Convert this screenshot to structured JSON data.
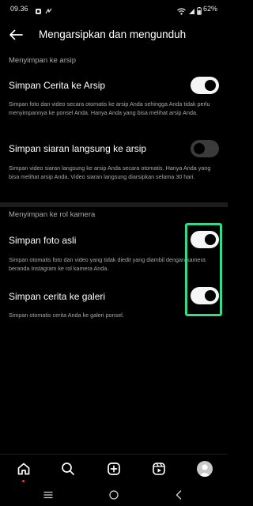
{
  "status_bar": {
    "time": "09.36",
    "battery": "62%",
    "icons": [
      "notification-icon",
      "app-icon",
      "wifi-icon",
      "signal-icon",
      "battery-icon"
    ]
  },
  "header": {
    "title": "Mengarsipkan dan mengunduh",
    "back_icon": "arrow-left-icon"
  },
  "sections": {
    "archive": {
      "title": "Menyimpan ke arsip",
      "story": {
        "label": "Simpan Cerita ke Arsip",
        "description": "Simpan foto dan video secara otomatis ke arsip Anda sehingga Anda tidak perlu menyimpannya ke ponsel Anda. Hanya Anda yang bisa melihat arsip Anda.",
        "enabled": true
      },
      "live": {
        "label": "Simpan siaran langsung ke arsip",
        "description": "Simpan video siaran langsung ke arsip Anda secara otomatis. Hanya Anda yang bisa melihat arsip Anda. Video siaran langsung diarsipkan selama 30 hari.",
        "enabled": false
      }
    },
    "camera_roll": {
      "title": "Menyimpan ke rol kamera",
      "original_photo": {
        "label": "Simpan foto asli",
        "description": "Simpan otomatis foto dan video yang tidak diedit yang diambil dengan kamera beranda Instagram ke rol kamera Anda.",
        "enabled": true
      },
      "story_gallery": {
        "label": "Simpan cerita ke galeri",
        "description": "Simpan otomatis cerita Anda ke galeri ponsel.",
        "enabled": true
      }
    }
  },
  "highlight_color": "#39d98a",
  "bottom_nav": [
    "home-icon",
    "search-icon",
    "create-icon",
    "reels-icon",
    "profile-avatar"
  ],
  "system_nav": [
    "menu-icon",
    "home-circle-icon",
    "back-chevron-icon"
  ]
}
